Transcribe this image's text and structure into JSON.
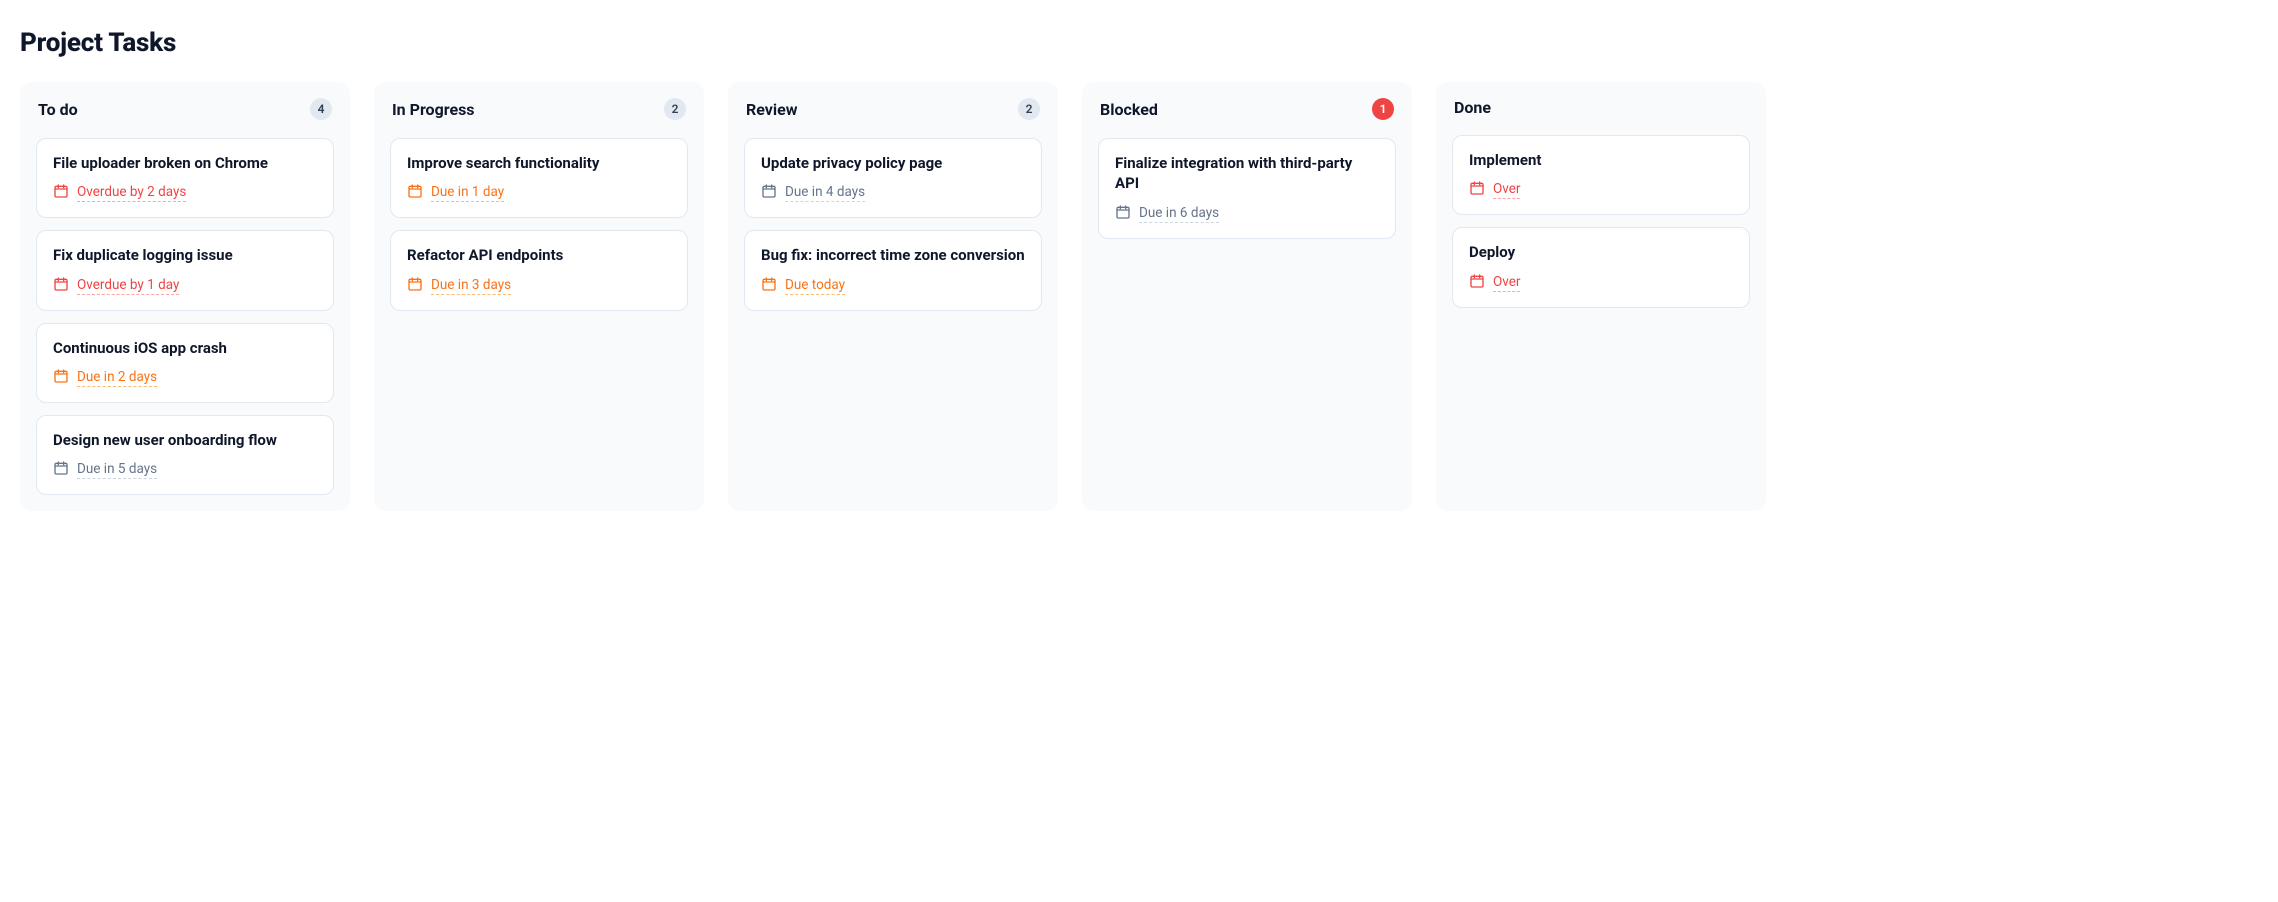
{
  "title": "Project Tasks",
  "columns": [
    {
      "id": "todo",
      "title": "To do",
      "count": "4",
      "alert": false,
      "cards": [
        {
          "title": "File uploader broken on Chrome",
          "due": "Overdue by 2 days",
          "status": "overdue"
        },
        {
          "title": "Fix duplicate logging issue",
          "due": "Overdue by 1 day",
          "status": "overdue"
        },
        {
          "title": "Continuous iOS app crash",
          "due": "Due in 2 days",
          "status": "warning"
        },
        {
          "title": "Design new user onboarding flow",
          "due": "Due in 5 days",
          "status": "normal"
        }
      ]
    },
    {
      "id": "in-progress",
      "title": "In Progress",
      "count": "2",
      "alert": false,
      "cards": [
        {
          "title": "Improve search functionality",
          "due": "Due in 1 day",
          "status": "warning"
        },
        {
          "title": "Refactor API endpoints",
          "due": "Due in 3 days",
          "status": "warning"
        }
      ]
    },
    {
      "id": "review",
      "title": "Review",
      "count": "2",
      "alert": false,
      "cards": [
        {
          "title": "Update privacy policy page",
          "due": "Due in 4 days",
          "status": "normal"
        },
        {
          "title": "Bug fix: incorrect time zone conversion",
          "due": "Due today",
          "status": "warning"
        }
      ]
    },
    {
      "id": "blocked",
      "title": "Blocked",
      "count": "1",
      "alert": true,
      "cards": [
        {
          "title": "Finalize integration with third-party API",
          "due": "Due in 6 days",
          "status": "normal"
        }
      ]
    },
    {
      "id": "done",
      "title": "Done",
      "count": "",
      "alert": false,
      "cards": [
        {
          "title": "Implement",
          "due": "Over",
          "status": "overdue"
        },
        {
          "title": "Deploy",
          "due": "Over",
          "status": "overdue"
        }
      ]
    }
  ]
}
